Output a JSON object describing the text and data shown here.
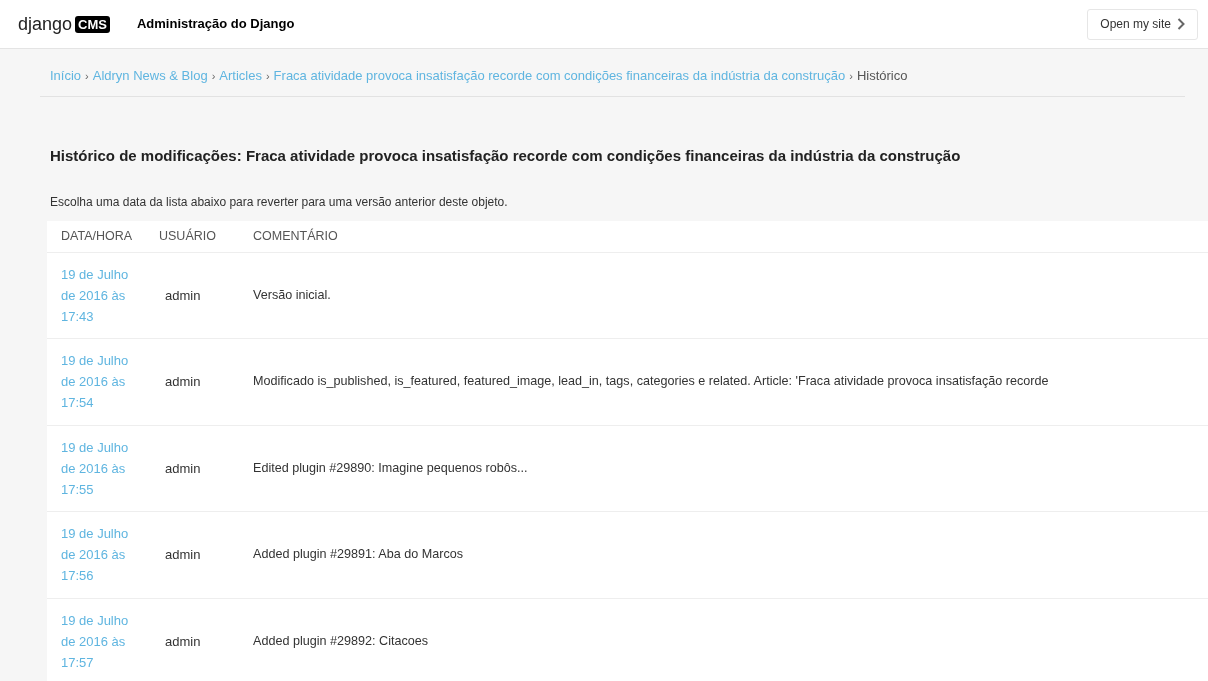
{
  "header": {
    "logo_text": "django",
    "logo_badge": "CMS",
    "title": "Administração do Django",
    "site_button": "Open my site"
  },
  "breadcrumbs": [
    {
      "label": "Início",
      "link": true
    },
    {
      "label": "Aldryn News & Blog",
      "link": true
    },
    {
      "label": "Articles",
      "link": true
    },
    {
      "label": "Fraca atividade provoca insatisfação recorde com condições financeiras da indústria da construção",
      "link": true
    },
    {
      "label": "Histórico",
      "link": false
    }
  ],
  "breadcrumb_separator": "›",
  "page_title": "Histórico de modificações: Fraca atividade provoca insatisfação recorde com condições financeiras da indústria da construção",
  "description": "Escolha uma data da lista abaixo para reverter para uma versão anterior deste objeto.",
  "table": {
    "columns": [
      "DATA/HORA",
      "USUÁRIO",
      "COMENTÁRIO"
    ],
    "rows": [
      {
        "date": "19 de Julho de 2016 às 17:43",
        "user": "admin",
        "comment": "Versão inicial."
      },
      {
        "date": "19 de Julho de 2016 às 17:54",
        "user": "admin",
        "comment": "Modificado is_published, is_featured, featured_image, lead_in, tags, categories e related. Article: 'Fraca atividade provoca insatisfação recorde"
      },
      {
        "date": "19 de Julho de 2016 às 17:55",
        "user": "admin",
        "comment": "Edited plugin #29890: Imagine pequenos robôs..."
      },
      {
        "date": "19 de Julho de 2016 às 17:56",
        "user": "admin",
        "comment": "Added plugin #29891: Aba do Marcos"
      },
      {
        "date": "19 de Julho de 2016 às 17:57",
        "user": "admin",
        "comment": "Added plugin #29892: Citacoes"
      }
    ]
  }
}
